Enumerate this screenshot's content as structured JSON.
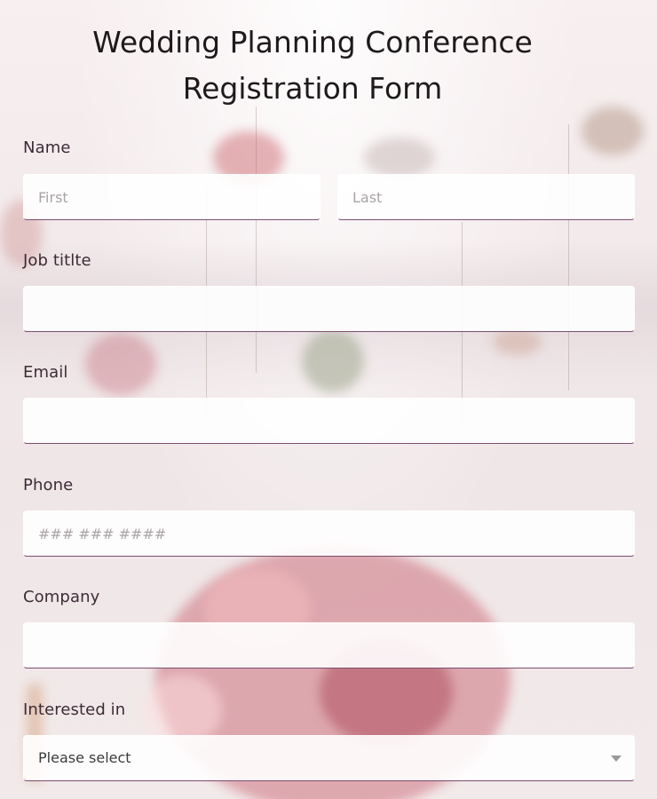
{
  "form": {
    "title_line1": "Wedding Planning Conference",
    "title_line2": "Registration Form"
  },
  "fields": {
    "name": {
      "label": "Name",
      "first_placeholder": "First",
      "last_placeholder": "Last"
    },
    "job_title": {
      "label": "Job titlte",
      "value": ""
    },
    "email": {
      "label": "Email",
      "value": ""
    },
    "phone": {
      "label": "Phone",
      "placeholder": "### ### ####"
    },
    "company": {
      "label": "Company",
      "value": ""
    },
    "interested_in": {
      "label": "Interested in",
      "selected": "Please select",
      "icon": "chevron-down-icon"
    }
  },
  "colors": {
    "accent": "#7b4d6e",
    "label": "#3d2b36",
    "title": "#1e1a1c"
  }
}
